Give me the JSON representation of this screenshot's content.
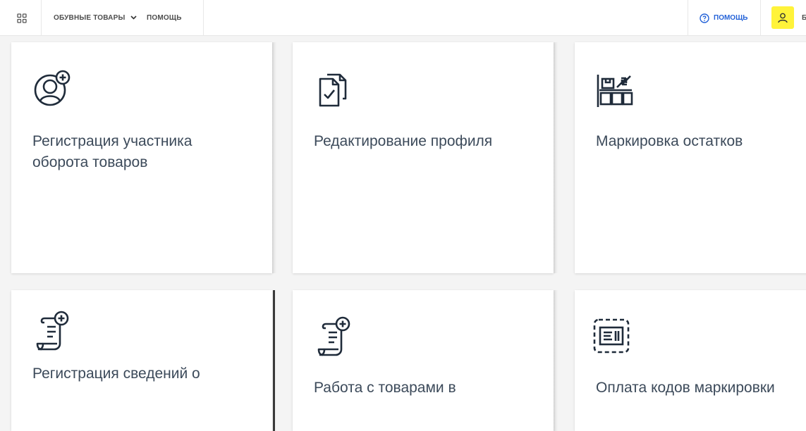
{
  "header": {
    "apps_icon": "apps-grid-icon",
    "product_label": "ОБУВНЫЕ ТОВАРЫ",
    "nav_help_label": "ПОМОЩЬ",
    "help_link_label": "ПОМОЩЬ",
    "help_icon": "question-circle-icon",
    "user_icon": "user-icon",
    "user_label": "Б",
    "accent_color": "#fff33a",
    "link_color": "#2563d8"
  },
  "cards": [
    {
      "title": "Регистрация участника оборота товаров",
      "icon": "user-add-icon"
    },
    {
      "title": "Редактирование профиля",
      "icon": "document-check-icon"
    },
    {
      "title": "Маркировка остатков",
      "icon": "boxes-labeling-icon"
    },
    {
      "title": "Регистрация сведений о",
      "icon": "scroll-add-icon"
    },
    {
      "title": "Работа с товарами в",
      "icon": "scroll-add-icon"
    },
    {
      "title": "Оплата кодов маркировки",
      "icon": "code-frame-icon"
    }
  ]
}
